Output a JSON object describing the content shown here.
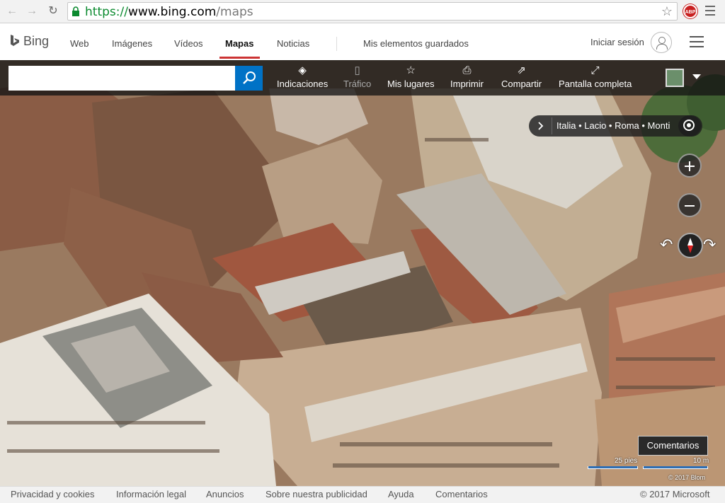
{
  "browser": {
    "url_scheme": "https://",
    "url_host": "www.bing.com",
    "url_path": "/maps",
    "adblock_label": "ABP"
  },
  "header": {
    "logo": "Bing",
    "nav": [
      "Web",
      "Imágenes",
      "Vídeos",
      "Mapas",
      "Noticias",
      "Mis elementos guardados"
    ],
    "active_tab": "Mapas",
    "signin": "Iniciar sesión"
  },
  "toolbar": {
    "search_value": "",
    "items": [
      {
        "label": "Indicaciones",
        "icon": "directions-icon"
      },
      {
        "label": "Tráfico",
        "icon": "traffic-icon"
      },
      {
        "label": "Mis lugares",
        "icon": "star-icon"
      },
      {
        "label": "Imprimir",
        "icon": "print-icon"
      },
      {
        "label": "Compartir",
        "icon": "share-icon"
      },
      {
        "label": "Pantalla completa",
        "icon": "fullscreen-icon"
      }
    ]
  },
  "map": {
    "breadcrumb": "Italia • Lacio • Roma • Monti",
    "feedback": "Comentarios",
    "scale_imperial": "25 pies",
    "scale_metric": "10 m",
    "copyright": "© 2017 Blom"
  },
  "footer": {
    "links": [
      "Privacidad y cookies",
      "Información legal",
      "Anuncios",
      "Sobre nuestra publicidad",
      "Ayuda",
      "Comentarios"
    ],
    "copyright": "© 2017 Microsoft"
  },
  "colors": {
    "accent": "#0072c6",
    "active_tab_underline": "#cc3333",
    "url_secure": "#0b8a2f"
  }
}
